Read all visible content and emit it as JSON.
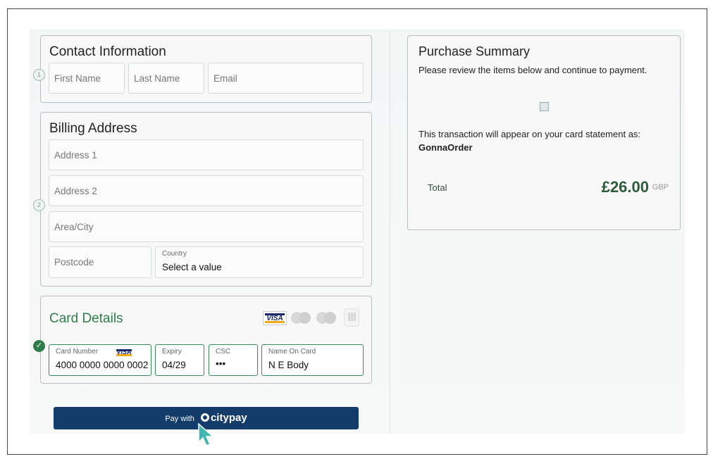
{
  "contact": {
    "title": "Contact Information",
    "step": "1",
    "first_name_placeholder": "First Name",
    "last_name_placeholder": "Last Name",
    "email_placeholder": "Email"
  },
  "billing": {
    "title": "Billing Address",
    "step": "2",
    "address1_placeholder": "Address 1",
    "address2_placeholder": "Address 2",
    "city_placeholder": "Area/City",
    "postcode_placeholder": "Postcode",
    "country_label": "Country",
    "country_value": "Select a value"
  },
  "card": {
    "title": "Card Details",
    "step_icon": "check-icon",
    "accepted_brands": [
      "visa-logo",
      "mastercard-logo",
      "maestro-logo",
      "chip-card-logo"
    ],
    "visa_text": "VISA",
    "number_label": "Card Number",
    "number_value": "4000 0000 0000 0002",
    "expiry_label": "Expiry",
    "expiry_value": "04/29",
    "csc_label": "CSC",
    "csc_value": "•••",
    "name_label": "Name On Card",
    "name_value": "N E Body"
  },
  "pay_button": {
    "prefix": "Pay with",
    "brand": "citypay",
    "color": "#133c6b"
  },
  "summary": {
    "title": "Purchase Summary",
    "subtitle": "Please review the items below and continue to payment.",
    "statement_note": "This transaction will appear on your card statement as:",
    "merchant": "GonnaOrder",
    "total_label": "Total",
    "total_amount": "£26.00",
    "currency": "GBP"
  },
  "colors": {
    "accent_green": "#2e7d4a",
    "pay_blue": "#133c6b"
  }
}
